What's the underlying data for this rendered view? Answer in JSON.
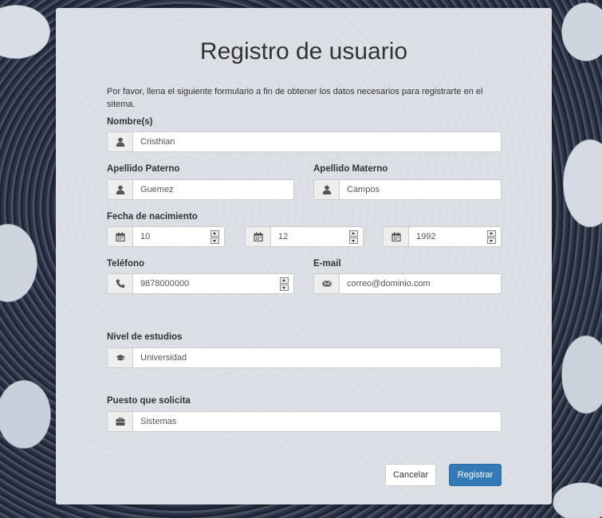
{
  "form": {
    "title": "Registro de usuario",
    "intro": "Por favor, llena el siguiente formulario a fin de obtener los datos necesarios para registrarte en el sitema.",
    "nombre": {
      "label": "Nombre(s)",
      "value": "Cristhian",
      "icon": "user-icon"
    },
    "apellido_paterno": {
      "label": "Apellido Paterno",
      "value": "Guemez",
      "icon": "user-icon"
    },
    "apellido_materno": {
      "label": "Apellido Materno",
      "value": "Campos",
      "icon": "user-icon"
    },
    "fecha": {
      "label": "Fecha de nacimiento",
      "day": "10",
      "month": "12",
      "year": "1992",
      "icon": "calendar-icon"
    },
    "telefono": {
      "label": "Teléfono",
      "value": "9878000000",
      "icon": "phone-icon"
    },
    "email": {
      "label": "E-mail",
      "value": "correo@dominio.com",
      "icon": "envelope-icon"
    },
    "nivel_estudios": {
      "label": "Nivel de estudios",
      "value": "Universidad",
      "icon": "graduation-cap-icon"
    },
    "puesto": {
      "label": "Puesto que solicita",
      "value": "Sistemas",
      "icon": "briefcase-icon"
    },
    "buttons": {
      "cancel": "Cancelar",
      "submit": "Registrar"
    },
    "colors": {
      "primary": "#337ab7",
      "panel": "#e9ecf2"
    }
  }
}
